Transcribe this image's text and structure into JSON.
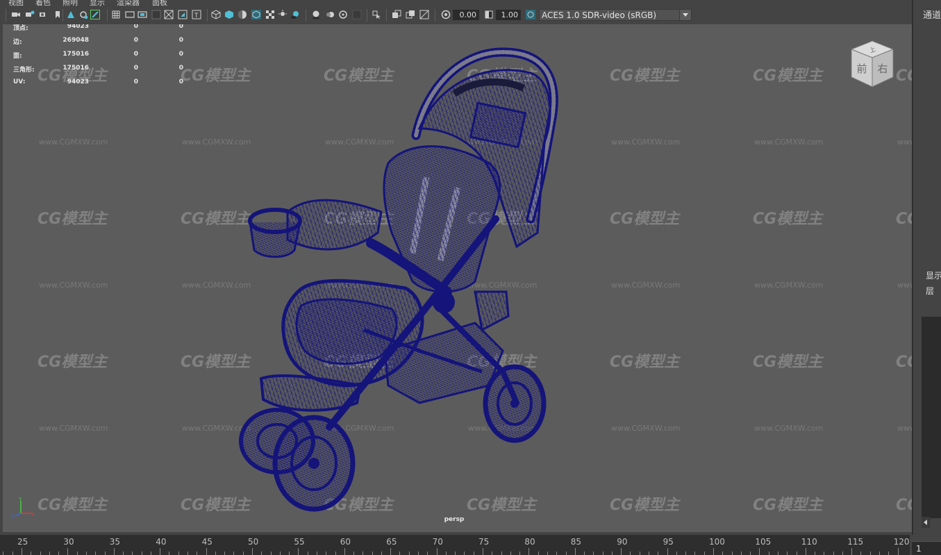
{
  "menu": {
    "items": [
      "视图",
      "着色",
      "照明",
      "显示",
      "渲染器",
      "面板"
    ]
  },
  "toolbar": {
    "exposure_value": "0.00",
    "gamma_value": "1.00",
    "color_management": "ACES 1.0 SDR-video (sRGB)"
  },
  "hud": {
    "rows": [
      {
        "label": "顶点:",
        "v1": "94023",
        "v2": "0",
        "v3": "0"
      },
      {
        "label": "边:",
        "v1": "269048",
        "v2": "0",
        "v3": "0"
      },
      {
        "label": "面:",
        "v1": "175016",
        "v2": "0",
        "v3": "0"
      },
      {
        "label": "三角形:",
        "v1": "175016",
        "v2": "0",
        "v3": "0"
      },
      {
        "label": "UV:",
        "v1": "94023",
        "v2": "0",
        "v3": "0"
      }
    ]
  },
  "viewport": {
    "camera_label": "persp",
    "background_color": "#5c5c5c",
    "wireframe_color": "#14147a"
  },
  "viewcube": {
    "top_label": "上",
    "front_label": "前",
    "right_label": "右"
  },
  "axis": {
    "x": "X",
    "y": "Y",
    "z": "Z"
  },
  "watermark": {
    "logo_text": "CG模型主",
    "url_text": "www.CGMXW.com"
  },
  "right_panel": {
    "channel_box_label": "通道",
    "display_label": "显示",
    "layer_label": "层"
  },
  "timeline": {
    "labels": [
      "25",
      "30",
      "35",
      "40",
      "45",
      "50",
      "55",
      "60",
      "65",
      "70",
      "75",
      "80",
      "85",
      "90",
      "95",
      "100",
      "105",
      "110",
      "115",
      "120"
    ],
    "current_frame": "1"
  }
}
